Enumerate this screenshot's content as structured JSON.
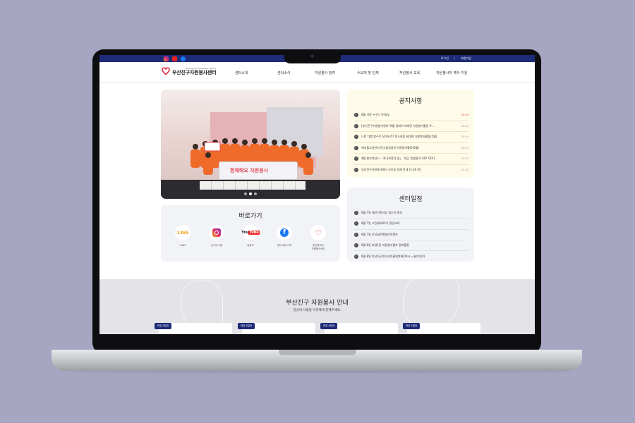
{
  "topbar": {
    "sns": [
      "instagram-icon",
      "youtube-icon",
      "facebook-icon"
    ],
    "login": "로그인",
    "join": "회원가입"
  },
  "header": {
    "logo_sub": "Busanjingu Volunteer Center",
    "logo_main": "부산진구자원봉사센터",
    "nav": [
      "센터소개",
      "센터소식",
      "자원봉사 참여",
      "수요처 및 단체",
      "자원봉사 교육",
      "자원봉사자 예우·지원"
    ]
  },
  "slide": {
    "banner_text": "함께해요 자원봉사",
    "dots": 3,
    "active_dot": 2
  },
  "quick": {
    "title": "바로가기",
    "items": [
      {
        "label": "1365",
        "icon": "1365-logo-icon"
      },
      {
        "label": "인스타그램",
        "icon": "instagram-icon"
      },
      {
        "label": "유튜브",
        "icon": "youtube-icon"
      },
      {
        "label": "센터 페이스북",
        "icon": "facebook-icon"
      },
      {
        "label": "부산광역시\n자원봉사센터",
        "icon": "heart-logo-icon"
      }
    ]
  },
  "notice": {
    "title": "공지사항",
    "items": [
      {
        "text": "6월 사랑 누구나 V-day",
        "date": "06.09",
        "highlight": true
      },
      {
        "text": "[부산진구자원봉사센터] 6월 릴레이 비대면 자원봉사활동 V-…",
        "date": "06.04",
        "highlight": false
      },
      {
        "text": "나만 다를 밥주걱 모아보걱? 탄소중립 비대면 자원봉사활동(5월)",
        "date": "05.04",
        "highlight": false
      },
      {
        "text": "에코힐고정한지 탄소중립실천 자원봉사활동(6월)",
        "date": "06.03",
        "highlight": false
      },
      {
        "text": "4월 봉사약선(~「호국보훈의 달」 기념, 빈밭갈기 GO! GO!)",
        "date": "05.03",
        "highlight": false
      },
      {
        "text": "부산진구자원봉사센터 사무실 부재 안내 (5.30.목)",
        "date": "05.28",
        "highlight": false
      }
    ]
  },
  "schedule": {
    "title": "센터일정",
    "items": [
      "6월 7일 재단가족사업 실무자 회의",
      "6월 7일 그린세워22기 환경교육",
      "6월 7일 부산글로벌빌리지캠프",
      "6월 8일 부암1동 자원봉사캠프 캠프활동",
      "6월 8일 부산진구청소년어울림축제(14시~,놀이마루)"
    ]
  },
  "guide": {
    "title": "부산진구 자원봉사 안내",
    "subtitle": "당신의 사랑을 이웃에게 전해주세요.",
    "cards": [
      "마감 8일전",
      "마감 8일전",
      "마감 9일전",
      "마감 9일전"
    ]
  }
}
